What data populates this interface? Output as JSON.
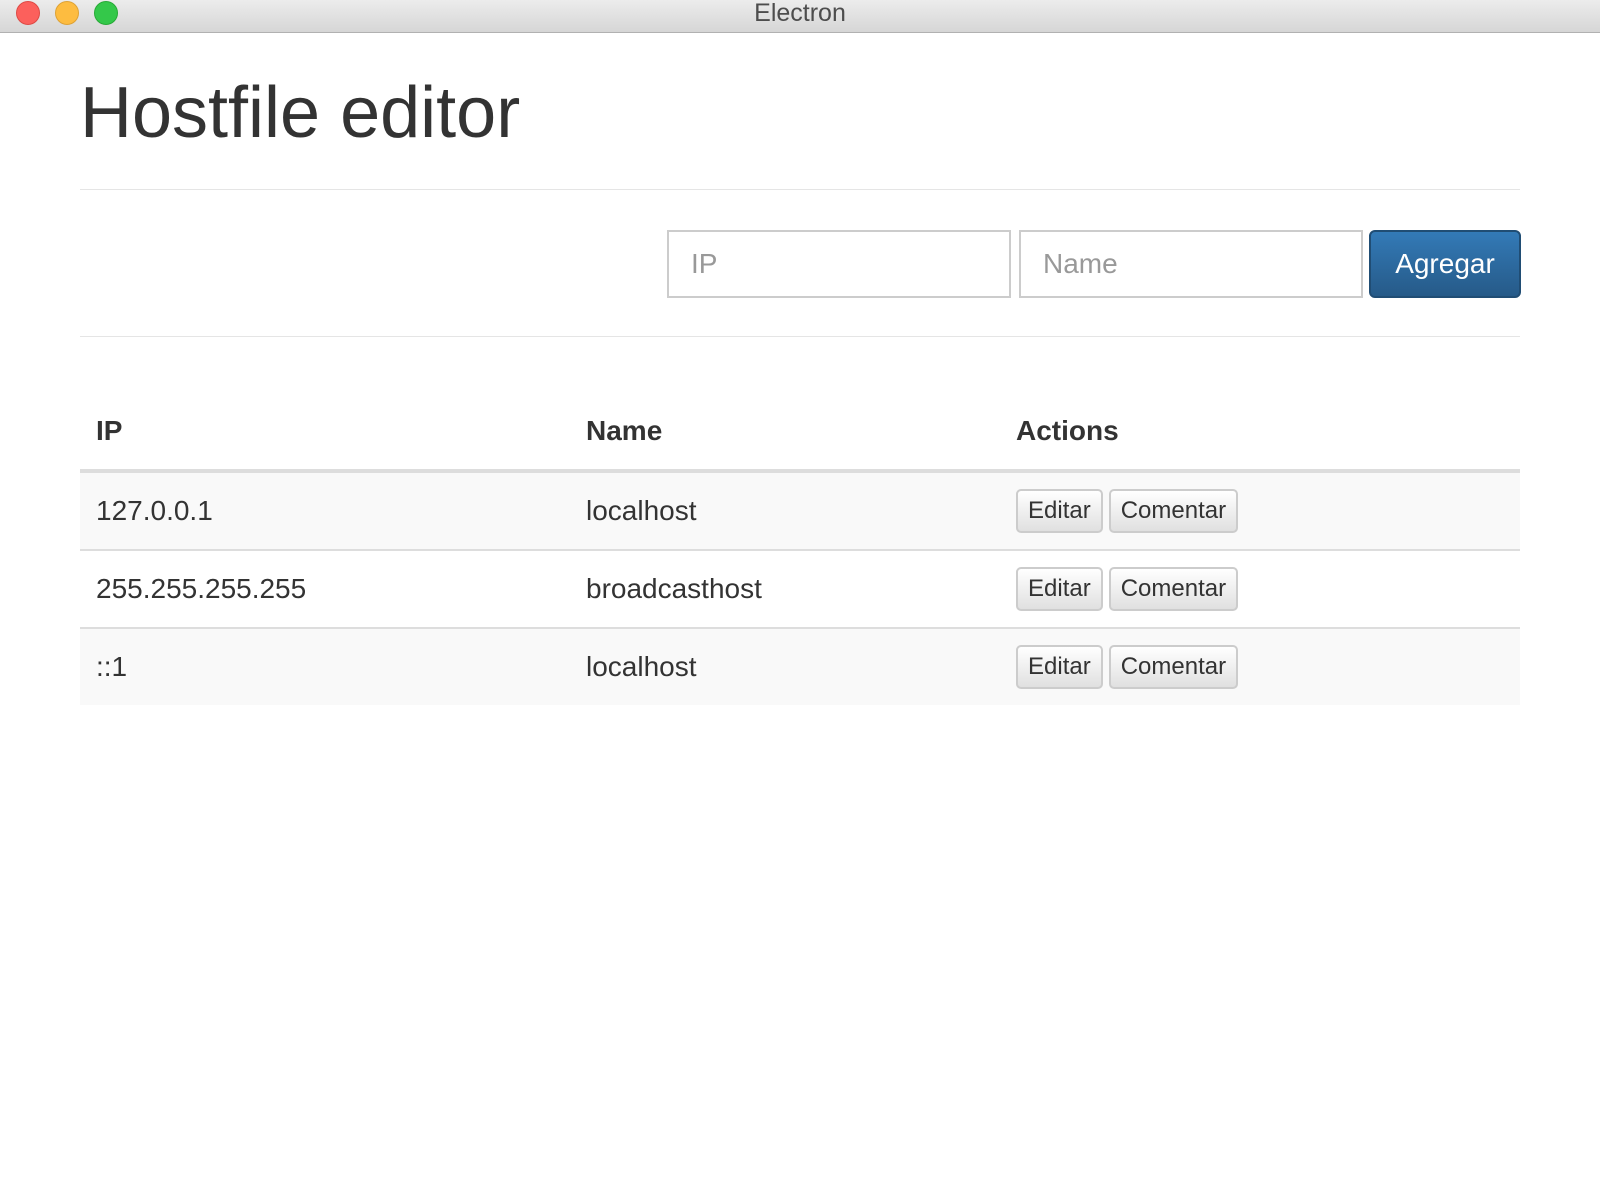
{
  "window": {
    "title": "Electron"
  },
  "page": {
    "title": "Hostfile editor"
  },
  "form": {
    "ip_placeholder": "IP",
    "ip_value": "",
    "name_placeholder": "Name",
    "name_value": "",
    "submit_label": "Agregar"
  },
  "table": {
    "headers": [
      "IP",
      "Name",
      "Actions"
    ],
    "rows": [
      {
        "ip": "127.0.0.1",
        "name": "localhost",
        "edit_label": "Editar",
        "comment_label": "Comentar"
      },
      {
        "ip": "255.255.255.255",
        "name": "broadcasthost",
        "edit_label": "Editar",
        "comment_label": "Comentar"
      },
      {
        "ip": "::1",
        "name": "localhost",
        "edit_label": "Editar",
        "comment_label": "Comentar"
      }
    ]
  },
  "colors": {
    "primary": "#337ab7",
    "primary_dark": "#265a88",
    "stripe": "#f9f9f9",
    "border": "#dddddd",
    "close": "#fc605c",
    "minimize": "#fdbc40",
    "maximize": "#34c84a"
  }
}
